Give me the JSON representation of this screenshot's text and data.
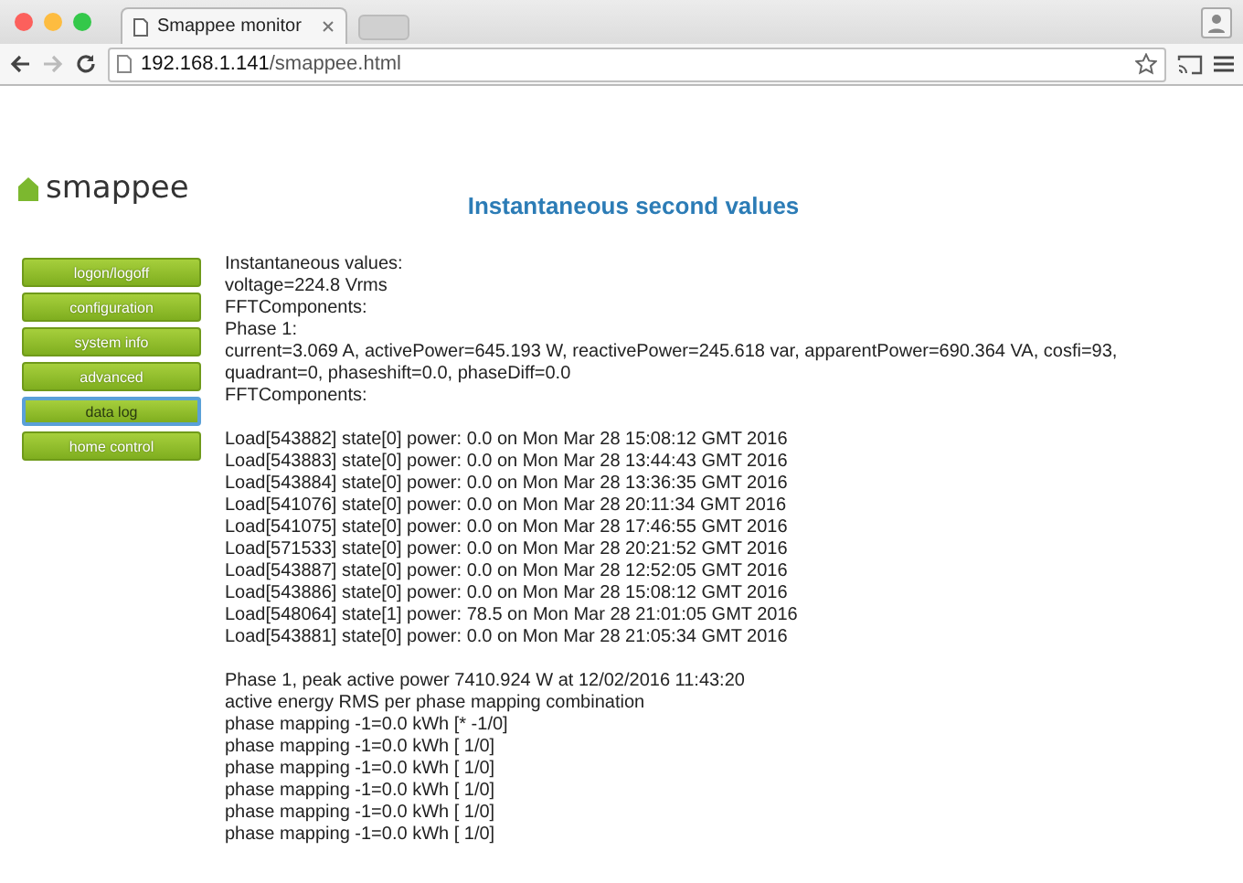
{
  "browser": {
    "tab_title": "Smappee monitor",
    "url_host": "192.168.1.141",
    "url_path": "/smappee.html"
  },
  "logo": "smappee",
  "page_title": "Instantaneous second values",
  "menu": [
    {
      "label": "logon/logoff",
      "selected": false
    },
    {
      "label": "configuration",
      "selected": false
    },
    {
      "label": "system info",
      "selected": false
    },
    {
      "label": "advanced",
      "selected": false
    },
    {
      "label": "data log",
      "selected": true
    },
    {
      "label": "home control",
      "selected": false
    }
  ],
  "sections": [
    [
      "Instantaneous values:",
      "voltage=224.8 Vrms",
      "FFTComponents:",
      "Phase 1:",
      "current=3.069 A, activePower=645.193 W, reactivePower=245.618 var, apparentPower=690.364 VA, cosfi=93, quadrant=0, phaseshift=0.0, phaseDiff=0.0",
      "FFTComponents:"
    ],
    [
      "Load[543882] state[0] power: 0.0 on Mon Mar 28 15:08:12 GMT 2016",
      "Load[543883] state[0] power: 0.0 on Mon Mar 28 13:44:43 GMT 2016",
      "Load[543884] state[0] power: 0.0 on Mon Mar 28 13:36:35 GMT 2016",
      "Load[541076] state[0] power: 0.0 on Mon Mar 28 20:11:34 GMT 2016",
      "Load[541075] state[0] power: 0.0 on Mon Mar 28 17:46:55 GMT 2016",
      "Load[571533] state[0] power: 0.0 on Mon Mar 28 20:21:52 GMT 2016",
      "Load[543887] state[0] power: 0.0 on Mon Mar 28 12:52:05 GMT 2016",
      "Load[543886] state[0] power: 0.0 on Mon Mar 28 15:08:12 GMT 2016",
      "Load[548064] state[1] power: 78.5 on Mon Mar 28 21:01:05 GMT 2016",
      "Load[543881] state[0] power: 0.0 on Mon Mar 28 21:05:34 GMT 2016"
    ],
    [
      "Phase 1, peak active power 7410.924 W at 12/02/2016 11:43:20",
      "active energy RMS per phase mapping combination",
      "phase mapping -1=0.0 kWh [* -1/0]",
      "phase mapping -1=0.0 kWh [ 1/0]",
      "phase mapping -1=0.0 kWh [ 1/0]",
      "phase mapping -1=0.0 kWh [ 1/0]",
      "phase mapping -1=0.0 kWh [ 1/0]",
      "phase mapping -1=0.0 kWh [ 1/0]"
    ]
  ]
}
